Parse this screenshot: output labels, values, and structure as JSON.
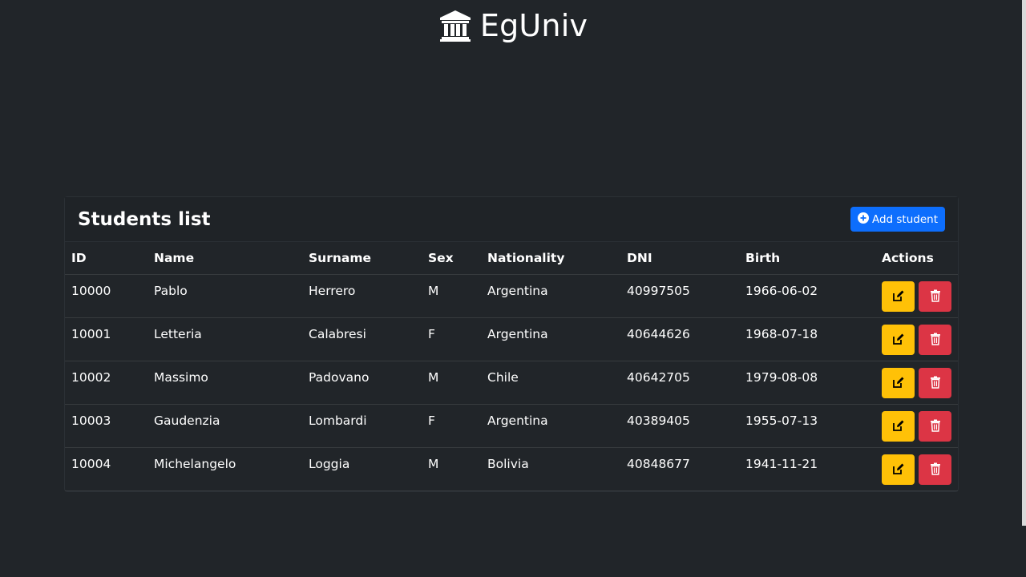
{
  "brand": {
    "name": "EgUniv",
    "icon": "bank-icon"
  },
  "card": {
    "title": "Students list",
    "add_button_label": "Add student",
    "add_button_icon": "plus-circle-icon"
  },
  "table": {
    "columns": [
      "ID",
      "Name",
      "Surname",
      "Sex",
      "Nationality",
      "DNI",
      "Birth",
      "Actions"
    ],
    "rows": [
      [
        "10000",
        "Pablo",
        "Herrero",
        "M",
        "Argentina",
        "40997505",
        "1966-06-02"
      ],
      [
        "10001",
        "Letteria",
        "Calabresi",
        "F",
        "Argentina",
        "40644626",
        "1968-07-18"
      ],
      [
        "10002",
        "Massimo",
        "Padovano",
        "M",
        "Chile",
        "40642705",
        "1979-08-08"
      ],
      [
        "10003",
        "Gaudenzia",
        "Lombardi",
        "F",
        "Argentina",
        "40389405",
        "1955-07-13"
      ],
      [
        "10004",
        "Michelangelo",
        "Loggia",
        "M",
        "Bolivia",
        "40848677",
        "1941-11-21"
      ]
    ],
    "row_actions": {
      "edit_icon": "edit-icon",
      "delete_icon": "trash-icon"
    }
  },
  "colors": {
    "background": "#212529",
    "primary": "#0d6efd",
    "warning": "#ffc107",
    "danger": "#dc3545"
  }
}
